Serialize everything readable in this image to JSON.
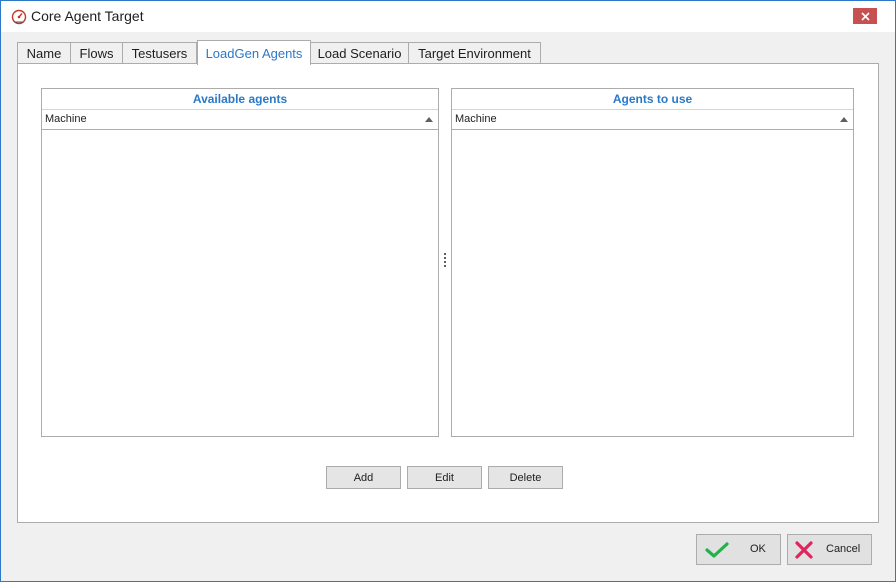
{
  "window": {
    "title": "Core Agent Target"
  },
  "tabs": [
    {
      "label": "Name"
    },
    {
      "label": "Flows"
    },
    {
      "label": "Testusers"
    },
    {
      "label": "LoadGen Agents",
      "active": true
    },
    {
      "label": "Load Scenario"
    },
    {
      "label": "Target Environment"
    }
  ],
  "available_grid": {
    "caption": "Available agents",
    "column": "Machine",
    "rows": []
  },
  "use_grid": {
    "caption": "Agents to use",
    "column": "Machine",
    "rows": []
  },
  "actions": {
    "add": "Add",
    "edit": "Edit",
    "delete": "Delete"
  },
  "footer": {
    "ok": "OK",
    "cancel": "Cancel"
  },
  "colors": {
    "accent": "#2b79c7",
    "ok_check": "#22b14c",
    "cancel_x": "#e0245e",
    "close_button": "#c75050"
  }
}
